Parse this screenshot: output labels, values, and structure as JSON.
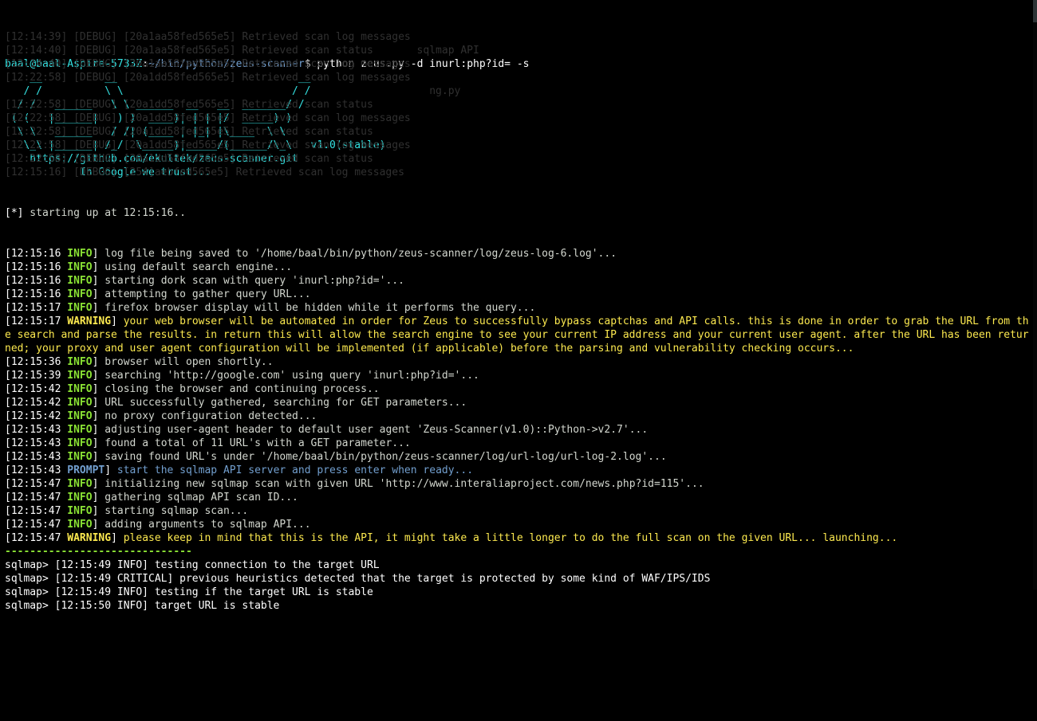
{
  "prompt": {
    "user": "baal",
    "host": "baal-Aspire-5733Z",
    "path": "~/bin/python/zeus-scanner",
    "command": "python zeus.py -d inurl:php?id= -s"
  },
  "banner": {
    "l0": "    __          __                             __   ",
    "l1": "   / /          \\ \\                           / /   ",
    "l2": "  / /   ______   \\ \\ ______  __   __  _______/ /    ",
    "l3": " ( (   |______|   ) )  ____)| | | |/  _____) )      ",
    "l4": "  \\ \\   ______   / /| (____ | |_| |\\____  \\ \\       ",
    "l5": "   \\_\\ |______| /_/  \\_____)|_____/(______/\\_\\   v1.0(stable)",
    "url": "    https://github.com/ekultek/zeus-scanner.git",
    "motto": "            In Google we trust..."
  },
  "startup": {
    "star": "[*]",
    "msg": " starting up at 12:15:16.."
  },
  "lines": [
    {
      "ts": "12:15:16",
      "lvl": "INFO",
      "msg": " log file being saved to '/home/baal/bin/python/zeus-scanner/log/zeus-log-6.log'..."
    },
    {
      "ts": "12:15:16",
      "lvl": "INFO",
      "msg": " using default search engine..."
    },
    {
      "ts": "12:15:16",
      "lvl": "INFO",
      "msg": " starting dork scan with query 'inurl:php?id='..."
    },
    {
      "ts": "12:15:16",
      "lvl": "INFO",
      "msg": " attempting to gather query URL..."
    },
    {
      "ts": "12:15:17",
      "lvl": "INFO",
      "msg": " firefox browser display will be hidden while it performs the query..."
    },
    {
      "ts": "12:15:17",
      "lvl": "WARNING",
      "msg": " your web browser will be automated in order for Zeus to successfully bypass captchas and API calls. this is done in order to grab the URL from the search and parse the results. in return this will allow the search engine to see your current IP address and your current user agent. after the URL has been returned; your proxy and user agent configuration will be implemented (if applicable) before the parsing and vulnerability checking occurs..."
    },
    {
      "ts": "12:15:36",
      "lvl": "INFO",
      "msg": " browser will open shortly.."
    },
    {
      "ts": "12:15:39",
      "lvl": "INFO",
      "msg": " searching 'http://google.com' using query 'inurl:php?id='..."
    },
    {
      "ts": "12:15:42",
      "lvl": "INFO",
      "msg": " closing the browser and continuing process.."
    },
    {
      "ts": "12:15:42",
      "lvl": "INFO",
      "msg": " URL successfully gathered, searching for GET parameters..."
    },
    {
      "ts": "12:15:42",
      "lvl": "INFO",
      "msg": " no proxy configuration detected..."
    },
    {
      "ts": "12:15:43",
      "lvl": "INFO",
      "msg": " adjusting user-agent header to default user agent 'Zeus-Scanner(v1.0)::Python->v2.7'..."
    },
    {
      "ts": "12:15:43",
      "lvl": "INFO",
      "msg": " found a total of 11 URL's with a GET parameter..."
    },
    {
      "ts": "12:15:43",
      "lvl": "INFO",
      "msg": " saving found URL's under '/home/baal/bin/python/zeus-scanner/log/url-log/url-log-2.log'..."
    },
    {
      "ts": "12:15:43",
      "lvl": "PROMPT",
      "msg": " start the sqlmap API server and press enter when ready..."
    },
    {
      "ts": "12:15:47",
      "lvl": "INFO",
      "msg": " initializing new sqlmap scan with given URL 'http://www.interaliaproject.com/news.php?id=115'..."
    },
    {
      "ts": "12:15:47",
      "lvl": "INFO",
      "msg": " gathering sqlmap API scan ID..."
    },
    {
      "ts": "12:15:47",
      "lvl": "INFO",
      "msg": " starting sqlmap scan..."
    },
    {
      "ts": "12:15:47",
      "lvl": "INFO",
      "msg": " adding arguments to sqlmap API..."
    },
    {
      "ts": "12:15:47",
      "lvl": "WARNING",
      "msg": " please keep in mind that this is the API, it might take a little longer to do the full scan on the given URL... launching..."
    }
  ],
  "divider": "------------------------------",
  "sqlmap": [
    {
      "pfx": "sqlmap> ",
      "ts": "12:15:49",
      "lbl": "INFO",
      "msg": " testing connection to the target URL"
    },
    {
      "pfx": "sqlmap> ",
      "ts": "12:15:49",
      "lbl": "CRITICAL",
      "msg": " previous heuristics detected that the target is protected by some kind of WAF/IPS/IDS"
    },
    {
      "pfx": "sqlmap> ",
      "ts": "12:15:49",
      "lbl": "INFO",
      "msg": " testing if the target URL is stable"
    },
    {
      "pfx": "sqlmap> ",
      "ts": "12:15:50",
      "lbl": "INFO",
      "msg": " target URL is stable"
    }
  ],
  "ghost": [
    "[12:14:39] [DEBUG] [20a1aa58fed565e5] Retrieved scan log messages",
    "[12:14:40] [DEBUG] [20a1aa58fed565e5] Retrieved scan status       sqlmap API",
    "[12:14:40] [DEBUG] [20a1aa58fed565e5] Retrieved scan log messages",
    "[12:22:58] [DEBUG] [20a1dd58fed565e5] Retrieved scan log messages",
    "                                                                    ng.py",
    "[12:22:58] [DEBUG] [20a1dd58fed565e5] Retrieved scan status",
    "[12:22:58] [DEBUG] [20a1dd58fed565e5] Retrieved scan log messages",
    "[12:22:58] [DEBUG] [20a1dd58fed565e5] Retrieved scan status",
    "[12:22:58] [DEBUG] [20a1dd58fed565e5] Retrieved scan log messages",
    "[12:22:58] [DEBUG] [20a1dd58fed565e5] Retrieved scan status",
    "[12:15:16] [DEBUG] [254]aebfed565e5] Retrieved scan log messages"
  ]
}
